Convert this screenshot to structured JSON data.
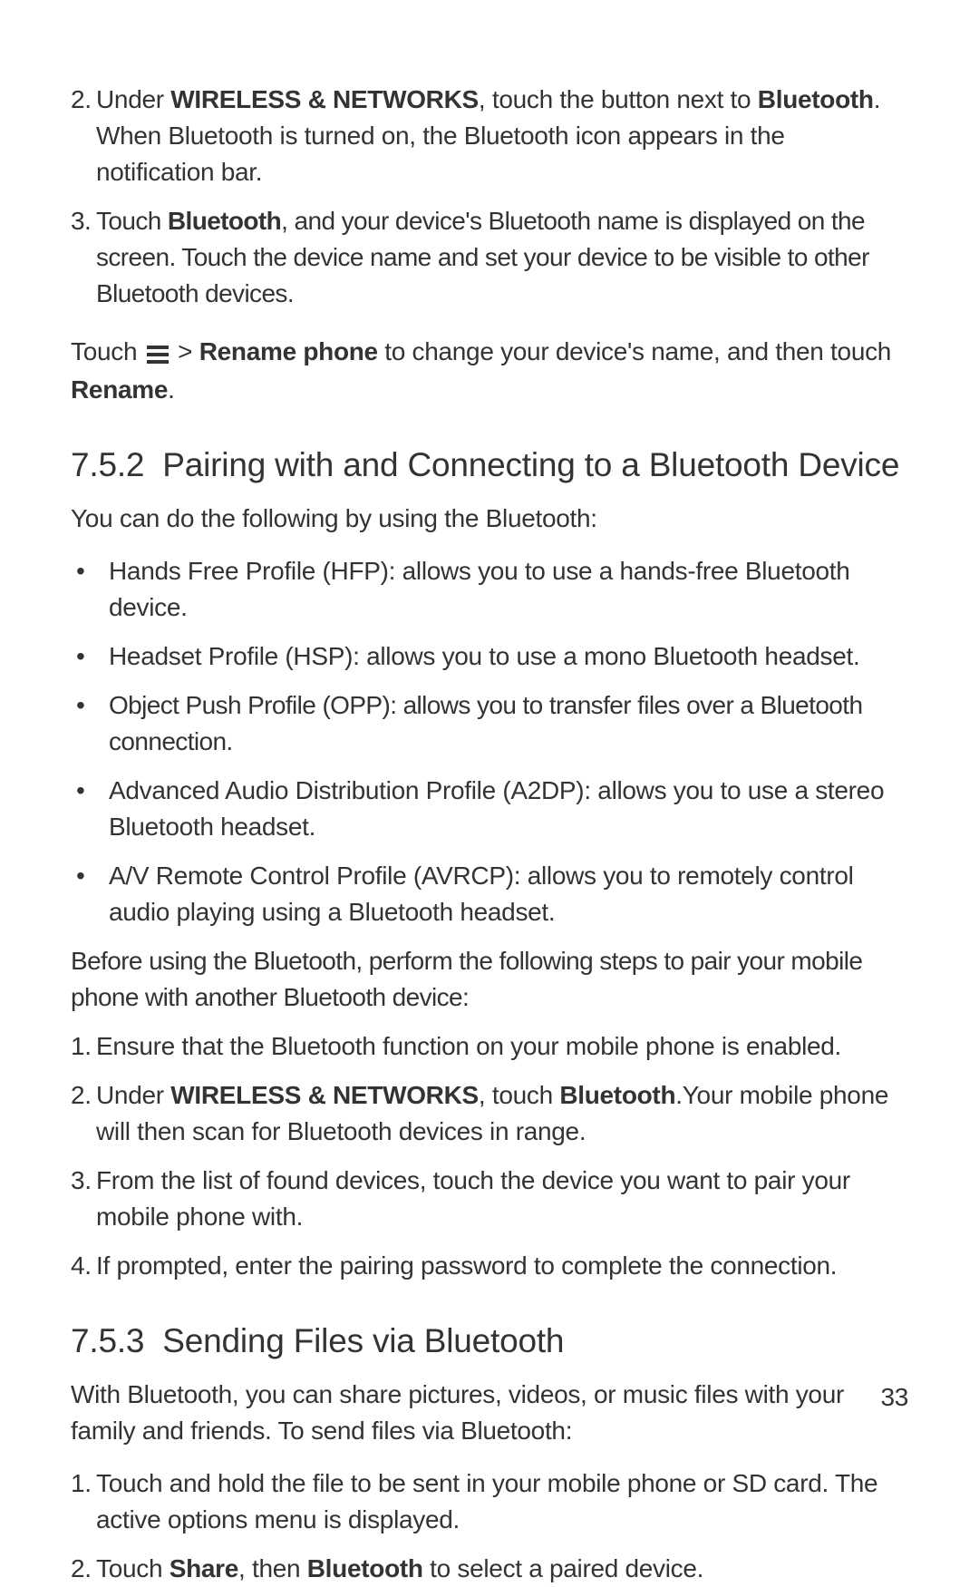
{
  "steps_a": [
    {
      "num": "2.",
      "pre": "Under ",
      "bold1": "WIRELESS & NETWORKS",
      "mid": ", touch the button next to ",
      "bold2": "Bluetooth",
      "post": ". When Bluetooth is turned on, the Bluetooth icon appears in the notification bar."
    },
    {
      "num": "3.",
      "pre": "Touch ",
      "bold1": "Bluetooth",
      "mid": "",
      "bold2": "",
      "post": ", and your device's Bluetooth name is displayed on the screen. Touch the device name and set your device to be visible to other Bluetooth devices."
    }
  ],
  "rename_para": {
    "pre": "Touch ",
    "gt": " > ",
    "bold1": "Rename phone",
    "mid": " to change your device's name, and then touch ",
    "bold2": "Rename",
    "post": "."
  },
  "section_752": {
    "num": "7.5.2",
    "title": "Pairing with and Connecting to a Bluetooth Device"
  },
  "intro_752": "You can do the following by using the Bluetooth:",
  "bullets_752": [
    "Hands Free Profile (HFP): allows you to use a hands-free Bluetooth device.",
    "Headset Profile (HSP): allows you to use a mono Bluetooth headset.",
    "Object Push Profile (OPP): allows you to transfer files over a Bluetooth connection.",
    "Advanced Audio Distribution Profile (A2DP): allows you to use a stereo Bluetooth headset.",
    "A/V Remote Control Profile (AVRCP): allows you to remotely control audio playing using a Bluetooth headset."
  ],
  "before_para": "Before using the Bluetooth, perform the following steps to pair your mobile phone with another Bluetooth device:",
  "steps_b": [
    {
      "num": "1.",
      "text": "Ensure that the Bluetooth function on your mobile phone is enabled."
    },
    {
      "num": "2.",
      "pre": "Under ",
      "bold1": "WIRELESS & NETWORKS",
      "mid": ", touch ",
      "bold2": "Bluetooth",
      "post": ".Your mobile phone will then scan for Bluetooth devices in range."
    },
    {
      "num": "3.",
      "text": "From the list of found devices, touch the device you want to pair your mobile phone with."
    },
    {
      "num": "4.",
      "text": "If prompted, enter the pairing password to complete the connection."
    }
  ],
  "section_753": {
    "num": "7.5.3",
    "title": "Sending Files via Bluetooth"
  },
  "intro_753": "With Bluetooth, you can share pictures, videos, or music files with your family and friends. To send files via Bluetooth:",
  "steps_c": [
    {
      "num": "1.",
      "text": "Touch and hold the file to be sent in your mobile phone or SD card. The active options menu is displayed."
    },
    {
      "num": "2.",
      "pre": "Touch ",
      "bold1": "Share",
      "mid": ", then ",
      "bold2": "Bluetooth",
      "post": " to select a paired device."
    }
  ],
  "page_number": "33",
  "dot": "•"
}
